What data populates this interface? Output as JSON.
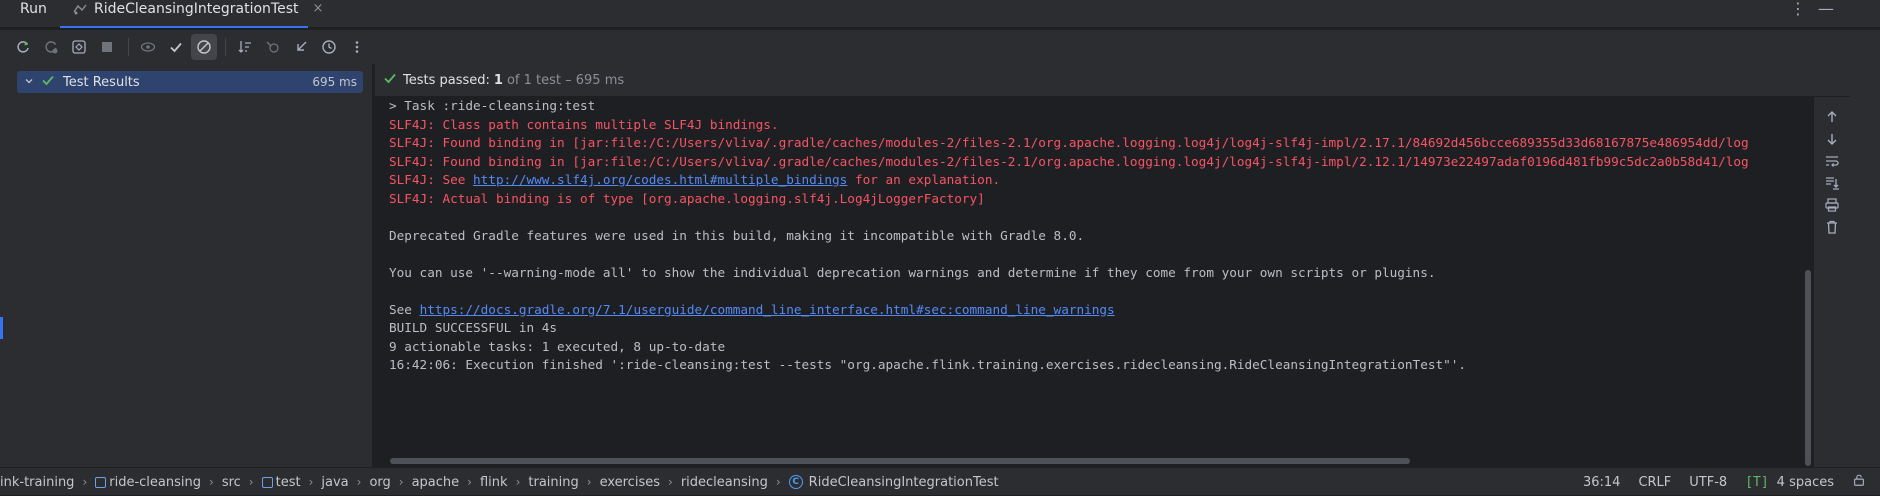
{
  "header": {
    "run_label": "Run",
    "tab_label": "RideCleansingIntegrationTest",
    "close_glyph": "×",
    "more_glyph": "⋮",
    "minimize_glyph": "—"
  },
  "toolbar": {
    "buttons": [
      "rerun-icon",
      "rerun-failed-icon",
      "toggle-auto-test-icon",
      "stop-icon",
      "show-ignored-icon",
      "show-passed-icon",
      "show-ignored-tests-icon",
      "sort-alphabetically-icon",
      "import-tests-icon",
      "collapse-icon",
      "history-icon",
      "more-icon"
    ]
  },
  "tree": {
    "root_label": "Test Results",
    "root_duration": "695 ms"
  },
  "status": {
    "prefix": "Tests passed:",
    "count": "1",
    "suffix": "of 1 test – 695 ms"
  },
  "console": {
    "lines": [
      {
        "type": "norm",
        "text": "> Task :ride-cleansing:test"
      },
      {
        "type": "err",
        "text": "SLF4J: Class path contains multiple SLF4J bindings."
      },
      {
        "type": "err",
        "text": "SLF4J: Found binding in [jar:file:/C:/Users/vliva/.gradle/caches/modules-2/files-2.1/org.apache.logging.log4j/log4j-slf4j-impl/2.17.1/84692d456bcce689355d33d68167875e486954dd/log"
      },
      {
        "type": "err",
        "text": "SLF4J: Found binding in [jar:file:/C:/Users/vliva/.gradle/caches/modules-2/files-2.1/org.apache.logging.log4j/log4j-slf4j-impl/2.12.1/14973e22497adaf0196d481fb99c5dc2a0b58d41/log"
      },
      {
        "type": "err-link",
        "before": "SLF4J: See ",
        "link": "http://www.slf4j.org/codes.html#multiple_bindings",
        "after": " for an explanation."
      },
      {
        "type": "err",
        "text": "SLF4J: Actual binding is of type [org.apache.logging.slf4j.Log4jLoggerFactory]"
      },
      {
        "type": "norm",
        "text": ""
      },
      {
        "type": "norm",
        "text": "Deprecated Gradle features were used in this build, making it incompatible with Gradle 8.0."
      },
      {
        "type": "norm",
        "text": ""
      },
      {
        "type": "norm",
        "text": "You can use '--warning-mode all' to show the individual deprecation warnings and determine if they come from your own scripts or plugins."
      },
      {
        "type": "norm",
        "text": ""
      },
      {
        "type": "norm-link",
        "before": "See ",
        "link": "https://docs.gradle.org/7.1/userguide/command_line_interface.html#sec:command_line_warnings",
        "after": ""
      },
      {
        "type": "norm",
        "text": "BUILD SUCCESSFUL in 4s"
      },
      {
        "type": "norm",
        "text": "9 actionable tasks: 1 executed, 8 up-to-date"
      },
      {
        "type": "norm",
        "text": "16:42:06: Execution finished ':ride-cleansing:test --tests \"org.apache.flink.training.exercises.ridecleansing.RideCleansingIntegrationTest\"'."
      }
    ]
  },
  "breadcrumbs": [
    {
      "label": "ink-training",
      "icon": false
    },
    {
      "label": "ride-cleansing",
      "icon": true
    },
    {
      "label": "src",
      "icon": false
    },
    {
      "label": "test",
      "icon": true
    },
    {
      "label": "java",
      "icon": false
    },
    {
      "label": "org",
      "icon": false
    },
    {
      "label": "apache",
      "icon": false
    },
    {
      "label": "flink",
      "icon": false
    },
    {
      "label": "training",
      "icon": false
    },
    {
      "label": "exercises",
      "icon": false
    },
    {
      "label": "ridecleansing",
      "icon": false
    },
    {
      "label": "RideCleansingIntegrationTest",
      "icon": "class"
    }
  ],
  "status_right": {
    "position": "36:14",
    "line_sep": "CRLF",
    "encoding": "UTF-8",
    "indent_icon": "[T]",
    "indent": "4 spaces"
  },
  "colors": {
    "accent": "#3574f0",
    "success": "#5fb865",
    "error_text": "#f75464",
    "link": "#548af7"
  }
}
